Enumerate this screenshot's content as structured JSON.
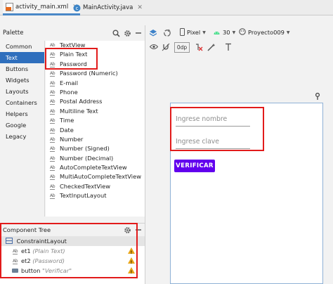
{
  "tabs": [
    {
      "label": "activity_main.xml",
      "active": true,
      "icon": "xml-file-icon"
    },
    {
      "label": "MainActivity.java",
      "active": false,
      "icon": "java-class-icon"
    }
  ],
  "palette": {
    "title": "Palette",
    "categories": [
      "Common",
      "Text",
      "Buttons",
      "Widgets",
      "Layouts",
      "Containers",
      "Helpers",
      "Google",
      "Legacy"
    ],
    "selected_category": "Text",
    "widgets": [
      {
        "label": "TextView",
        "icon": "Ab"
      },
      {
        "label": "Plain Text",
        "icon": "Ab"
      },
      {
        "label": "Password",
        "icon": "Ab"
      },
      {
        "label": "Password (Numeric)",
        "icon": "Ab"
      },
      {
        "label": "E-mail",
        "icon": "Ab"
      },
      {
        "label": "Phone",
        "icon": "Ab"
      },
      {
        "label": "Postal Address",
        "icon": "Ab"
      },
      {
        "label": "Multiline Text",
        "icon": "Ab"
      },
      {
        "label": "Time",
        "icon": "Ab"
      },
      {
        "label": "Date",
        "icon": "Ab"
      },
      {
        "label": "Number",
        "icon": "Ab"
      },
      {
        "label": "Number (Signed)",
        "icon": "Ab"
      },
      {
        "label": "Number (Decimal)",
        "icon": "Ab"
      },
      {
        "label": "AutoCompleteTextView",
        "icon": "Ab"
      },
      {
        "label": "MultiAutoCompleteTextView",
        "icon": "Ab"
      },
      {
        "label": "CheckedTextView",
        "icon": "Ab"
      },
      {
        "label": "TextInputLayout",
        "icon": "Ab"
      }
    ]
  },
  "component_tree": {
    "title": "Component Tree",
    "root": "ConstraintLayout",
    "children": [
      {
        "id": "et1",
        "detail": "(Plain Text)",
        "icon": "Ab",
        "warning": true
      },
      {
        "id": "et2",
        "detail": "(Password)",
        "icon": "Ab",
        "warning": true
      },
      {
        "id": "button",
        "detail": "\"Verificar\"",
        "icon": "button-icon",
        "warning": true
      }
    ]
  },
  "toolbar": {
    "device": "Pixel",
    "api_level": "30",
    "theme": "Proyecto009",
    "default_margin": "0dp"
  },
  "preview": {
    "field1_hint": "Ingrese nombre",
    "field2_hint": "Ingrese clave",
    "button_label": "VERIFICAR",
    "button_color": "#6200ee"
  },
  "colors": {
    "highlight": "#e21b1b",
    "selection": "#2f6fbd",
    "warning": "#e8a417"
  }
}
